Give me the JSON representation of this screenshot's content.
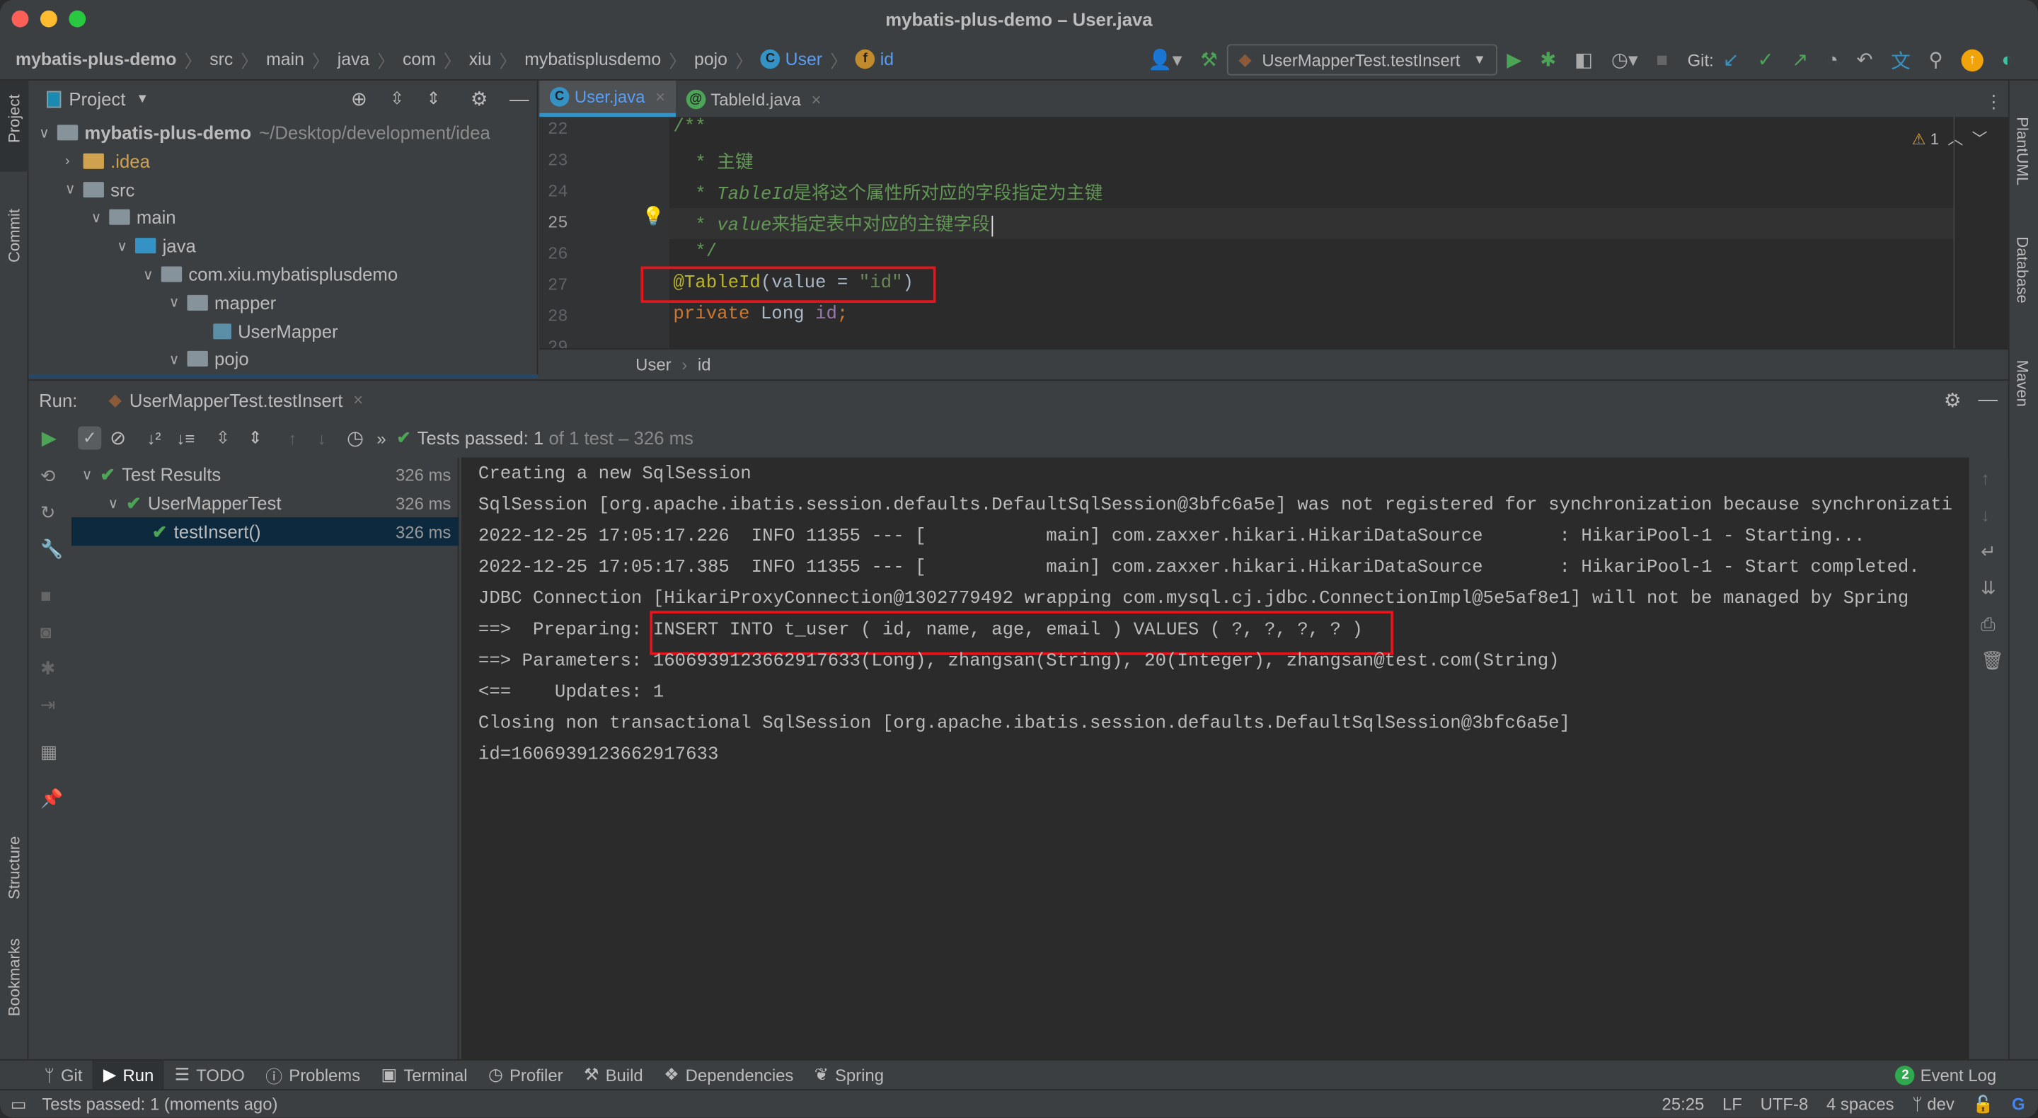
{
  "window": {
    "title": "mybatis-plus-demo – User.java"
  },
  "navbar": {
    "breadcrumbs": [
      "mybatis-plus-demo",
      "src",
      "main",
      "java",
      "com",
      "xiu",
      "mybatisplusdemo",
      "pojo"
    ],
    "class_crumb": "User",
    "field_crumb": "id",
    "run_config": "UserMapperTest.testInsert",
    "git_label": "Git:"
  },
  "left_strip": {
    "project": "Project",
    "commit": "Commit",
    "structure": "Structure",
    "bookmarks": "Bookmarks"
  },
  "right_strip": {
    "plantuml": "PlantUML",
    "database": "Database",
    "maven": "Maven"
  },
  "project": {
    "header": "Project",
    "root": {
      "name": "mybatis-plus-demo",
      "path": "~/Desktop/development/idea"
    },
    "items": [
      {
        "label": ".idea",
        "depth": 1,
        "type": "folder",
        "expanded": false,
        "color": "#d0a24f"
      },
      {
        "label": "src",
        "depth": 1,
        "type": "folder",
        "expanded": true
      },
      {
        "label": "main",
        "depth": 2,
        "type": "folder",
        "expanded": true
      },
      {
        "label": "java",
        "depth": 3,
        "type": "folder",
        "expanded": true,
        "color": "#3592c4"
      },
      {
        "label": "com.xiu.mybatisplusdemo",
        "depth": 4,
        "type": "package",
        "expanded": true
      },
      {
        "label": "mapper",
        "depth": 5,
        "type": "package",
        "expanded": true
      },
      {
        "label": "UserMapper",
        "depth": 6,
        "type": "mapper"
      },
      {
        "label": "pojo",
        "depth": 5,
        "type": "package",
        "expanded": true
      }
    ]
  },
  "editor": {
    "tabs": [
      {
        "label": "User.java",
        "active": true
      },
      {
        "label": "TableId.java",
        "active": false
      }
    ],
    "warning_count": "1",
    "lines": [
      {
        "n": "22",
        "tokens": [
          [
            "/**",
            "c-doc"
          ]
        ]
      },
      {
        "n": "23",
        "tokens": [
          [
            "  * ",
            "c-doc"
          ],
          [
            "主键",
            "c-doc"
          ]
        ]
      },
      {
        "n": "24",
        "tokens": [
          [
            "  * ",
            "c-doc"
          ],
          [
            "TableId",
            "c-doci"
          ],
          [
            "是将这个属性所对应的字段指定为主键",
            "c-doc"
          ]
        ]
      },
      {
        "n": "25",
        "tokens": [
          [
            "  * ",
            "c-doc"
          ],
          [
            "value",
            "c-doci"
          ],
          [
            "来指定表中对应的主键字段",
            "c-doc"
          ]
        ]
      },
      {
        "n": "26",
        "tokens": [
          [
            "  */",
            "c-doc"
          ]
        ]
      },
      {
        "n": "27",
        "tokens": [
          [
            "@TableId",
            "c-ann"
          ],
          [
            "(value = ",
            ""
          ],
          [
            "\"id\"",
            "c-str"
          ],
          [
            ")",
            ""
          ]
        ]
      },
      {
        "n": "28",
        "tokens": [
          [
            "private ",
            "c-kw"
          ],
          [
            "Long ",
            ""
          ],
          [
            "id",
            "c-field"
          ],
          [
            ";",
            "c-kw"
          ]
        ]
      },
      {
        "n": "29",
        "tokens": []
      }
    ],
    "breadcrumb": [
      "User",
      "id"
    ]
  },
  "run": {
    "label": "Run:",
    "tab": "UserMapperTest.testInsert",
    "status": {
      "prefix": "Tests passed: ",
      "passed": "1",
      "suffix": " of 1 test – 326 ms"
    },
    "tree": [
      {
        "label": "Test Results",
        "time": "326 ms",
        "depth": 0
      },
      {
        "label": "UserMapperTest",
        "time": "326 ms",
        "depth": 1
      },
      {
        "label": "testInsert()",
        "time": "326 ms",
        "depth": 2,
        "selected": true
      }
    ],
    "console": [
      "Creating a new SqlSession",
      "SqlSession [org.apache.ibatis.session.defaults.DefaultSqlSession@3bfc6a5e] was not registered for synchronization because synchronizati",
      "2022-12-25 17:05:17.226  INFO 11355 --- [           main] com.zaxxer.hikari.HikariDataSource       : HikariPool-1 - Starting...",
      "2022-12-25 17:05:17.385  INFO 11355 --- [           main] com.zaxxer.hikari.HikariDataSource       : HikariPool-1 - Start completed.",
      "JDBC Connection [HikariProxyConnection@1302779492 wrapping com.mysql.cj.jdbc.ConnectionImpl@5e5af8e1] will not be managed by Spring",
      "==>  Preparing: INSERT INTO t_user ( id, name, age, email ) VALUES ( ?, ?, ?, ? )",
      "==> Parameters: 1606939123662917633(Long), zhangsan(String), 20(Integer), zhangsan@test.com(String)",
      "<==    Updates: 1",
      "Closing non transactional SqlSession [org.apache.ibatis.session.defaults.DefaultSqlSession@3bfc6a5e]",
      "id=1606939123662917633"
    ]
  },
  "bottom_tools": [
    "Git",
    "Run",
    "TODO",
    "Problems",
    "Terminal",
    "Profiler",
    "Build",
    "Dependencies",
    "Spring"
  ],
  "event_log": {
    "count": "2",
    "label": "Event Log"
  },
  "status": {
    "message": "Tests passed: 1 (moments ago)",
    "position": "25:25",
    "line_sep": "LF",
    "encoding": "UTF-8",
    "indent": "4 spaces",
    "branch": "dev"
  },
  "colors": {
    "accent": "#3592c4",
    "pass": "#4ca457",
    "highlight": "#e8141b",
    "selection": "#0d293e"
  }
}
